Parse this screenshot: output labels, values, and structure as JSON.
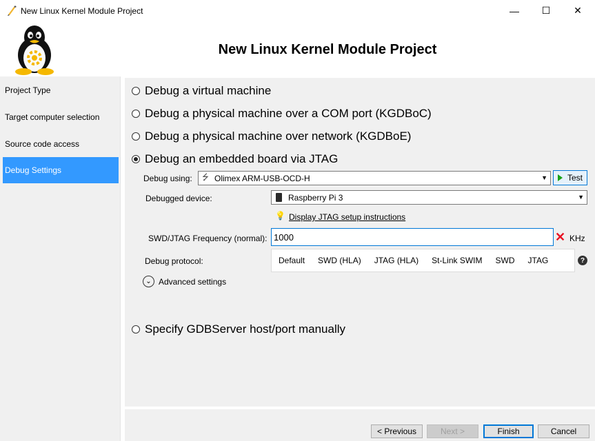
{
  "window": {
    "title": "New Linux Kernel Module Project",
    "minimize_glyph": "—",
    "maximize_glyph": "☐",
    "close_glyph": "✕"
  },
  "header": {
    "title": "New Linux Kernel Module Project",
    "logo_icon": "tux-penguin-icon"
  },
  "sidebar": {
    "items": [
      {
        "label": "Project Type",
        "active": false
      },
      {
        "label": "Target computer selection",
        "active": false
      },
      {
        "label": "Source code access",
        "active": false
      },
      {
        "label": "Debug Settings",
        "active": true
      }
    ]
  },
  "debug_modes": {
    "virtual_machine": "Debug a virtual machine",
    "com_port": "Debug a physical machine over a COM port (KGDBoC)",
    "network": "Debug a physical machine over network (KGDBoE)",
    "jtag": "Debug an embedded board via JTAG",
    "gdbserver": "Specify GDBServer host/port manually",
    "selected": "jtag"
  },
  "jtag": {
    "debug_using_label": "Debug using:",
    "debug_using_value": "Olimex ARM-USB-OCD-H",
    "test_label": "Test",
    "device_label": "Debugged device:",
    "device_value": "Raspberry Pi 3",
    "setup_link": "Display JTAG setup instructions",
    "freq_label": "SWD/JTAG Frequency (normal):",
    "freq_value": "1000",
    "freq_unit": "KHz",
    "protocol_label": "Debug protocol:",
    "protocol_options": [
      "Default",
      "SWD (HLA)",
      "JTAG (HLA)",
      "St-Link SWIM",
      "SWD",
      "JTAG"
    ],
    "help_glyph": "?",
    "advanced_label": "Advanced settings",
    "advanced_glyph": "⌄",
    "x_glyph": "✕",
    "bulb_glyph": "💡",
    "usb_glyph": "⭍",
    "combo_arrow": "▼"
  },
  "buttons": {
    "previous": "< Previous",
    "next": "Next >",
    "finish": "Finish",
    "cancel": "Cancel"
  },
  "colors": {
    "accent": "#3399ff",
    "panel": "#f0f0f0",
    "focus_border": "#0078d7",
    "error": "#e81123",
    "test_play": "#18a218"
  }
}
